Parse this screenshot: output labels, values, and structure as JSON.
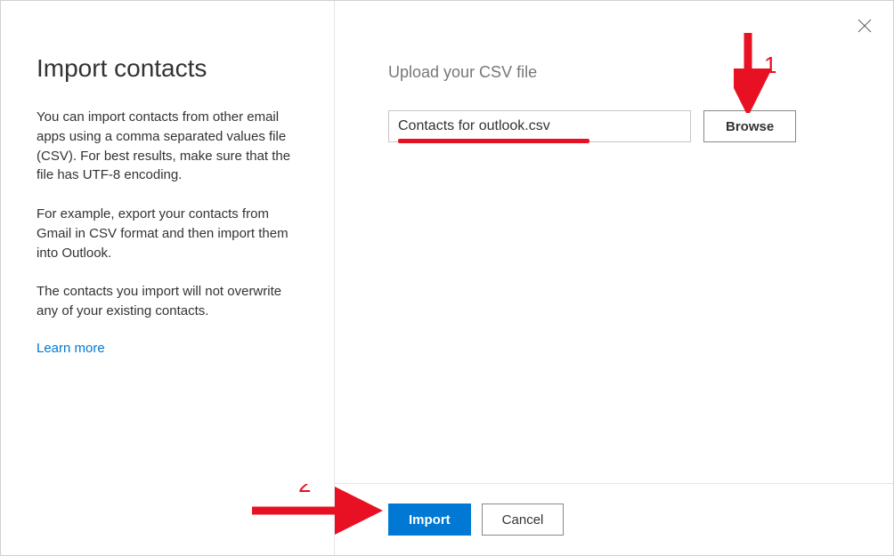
{
  "sidebar": {
    "title": "Import contacts",
    "para1": "You can import contacts from other email apps using a comma separated values file (CSV). For best results, make sure that the file has UTF-8 encoding.",
    "para2": "For example, export your contacts from Gmail in CSV format and then import them into Outlook.",
    "para3": "The contacts you import will not overwrite any of your existing contacts.",
    "learn_more": "Learn more"
  },
  "main": {
    "upload_label": "Upload your CSV file",
    "file_value": "Contacts for outlook.csv",
    "browse_label": "Browse"
  },
  "footer": {
    "import_label": "Import",
    "cancel_label": "Cancel"
  },
  "annotations": {
    "num1": "1",
    "num2": "2"
  }
}
